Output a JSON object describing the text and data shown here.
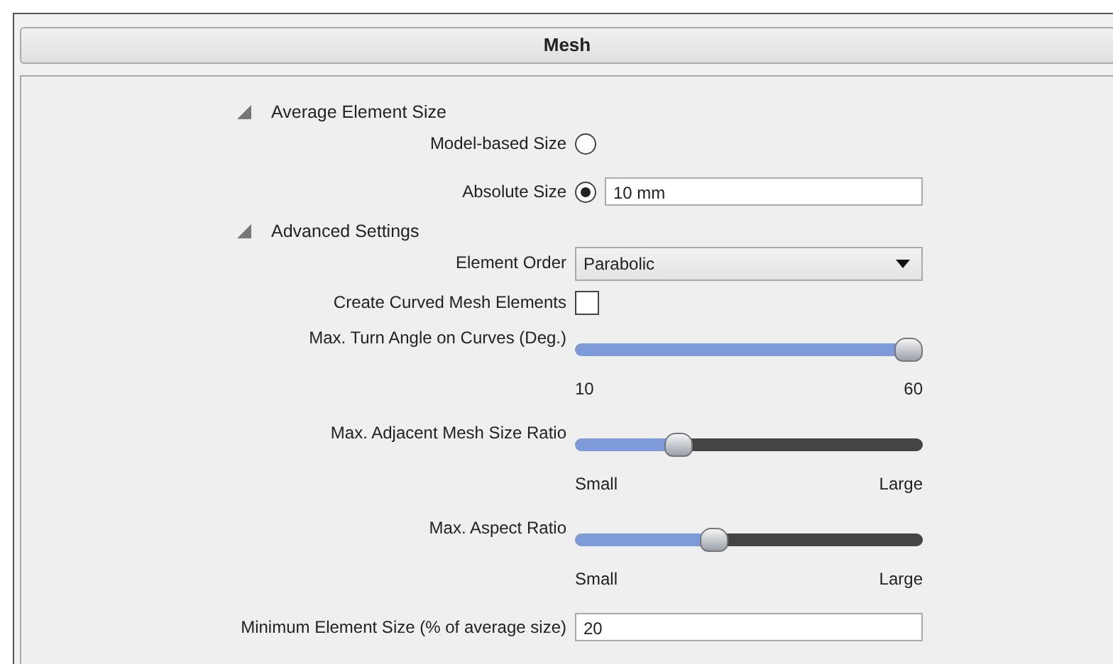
{
  "panel": {
    "title": "Mesh"
  },
  "sections": [
    {
      "title": "Average Element Size",
      "expanded": true,
      "items": [
        {
          "kind": "radio",
          "label": "Model-based Size",
          "selected": false
        },
        {
          "kind": "radio",
          "label": "Absolute Size",
          "selected": true,
          "value": "10 mm"
        }
      ]
    },
    {
      "title": "Advanced Settings",
      "expanded": true,
      "items": [
        {
          "kind": "dropdown",
          "label": "Element Order",
          "value": "Parabolic"
        },
        {
          "kind": "checkbox",
          "label": "Create Curved Mesh Elements",
          "checked": false
        },
        {
          "kind": "slider",
          "label": "Max. Turn Angle on Curves (Deg.)",
          "level": 1.0,
          "min_label": "10",
          "max_label": "60"
        },
        {
          "kind": "slider",
          "label": "Max. Adjacent Mesh Size Ratio",
          "level": 0.28,
          "min_label": "Small",
          "max_label": "Large"
        },
        {
          "kind": "slider",
          "label": "Max. Aspect Ratio",
          "level": 0.39,
          "min_label": "Small",
          "max_label": "Large"
        },
        {
          "kind": "text",
          "label": "Minimum Element Size (% of average size)",
          "value": "20"
        }
      ]
    }
  ]
}
